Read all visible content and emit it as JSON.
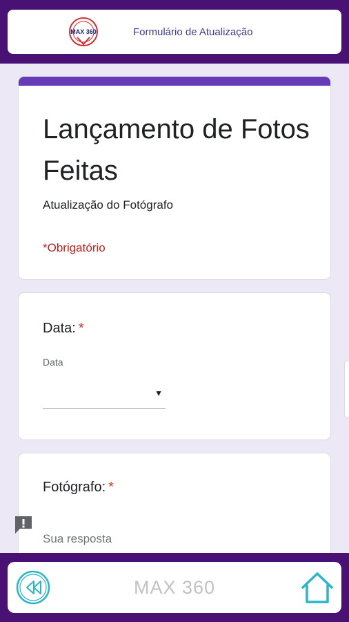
{
  "header": {
    "logo_text": "MAX 360",
    "title": "Formulário de Atualização"
  },
  "form": {
    "title": "Lançamento de Fotos Feitas",
    "description": "Atualização do Fotógrafo",
    "required_note": "*Obrigatório",
    "accent_color": "#673ab7",
    "questions": [
      {
        "label": "Data:",
        "required_mark": "*",
        "sublabel": "Data",
        "value": "",
        "dropdown_icon": "triangle-down-icon"
      },
      {
        "label": "Fotógrafo:",
        "required_mark": "*",
        "placeholder": "Sua resposta"
      }
    ]
  },
  "feedback": {
    "icon": "report-problem-icon"
  },
  "footer": {
    "title": "MAX 360",
    "back_icon": "rewind-back-icon",
    "home_icon": "home-icon"
  },
  "colors": {
    "frame": "#4a1174",
    "background": "#ece8f5",
    "icon_teal": "#29b6c8",
    "required_red": "#c5221f"
  }
}
